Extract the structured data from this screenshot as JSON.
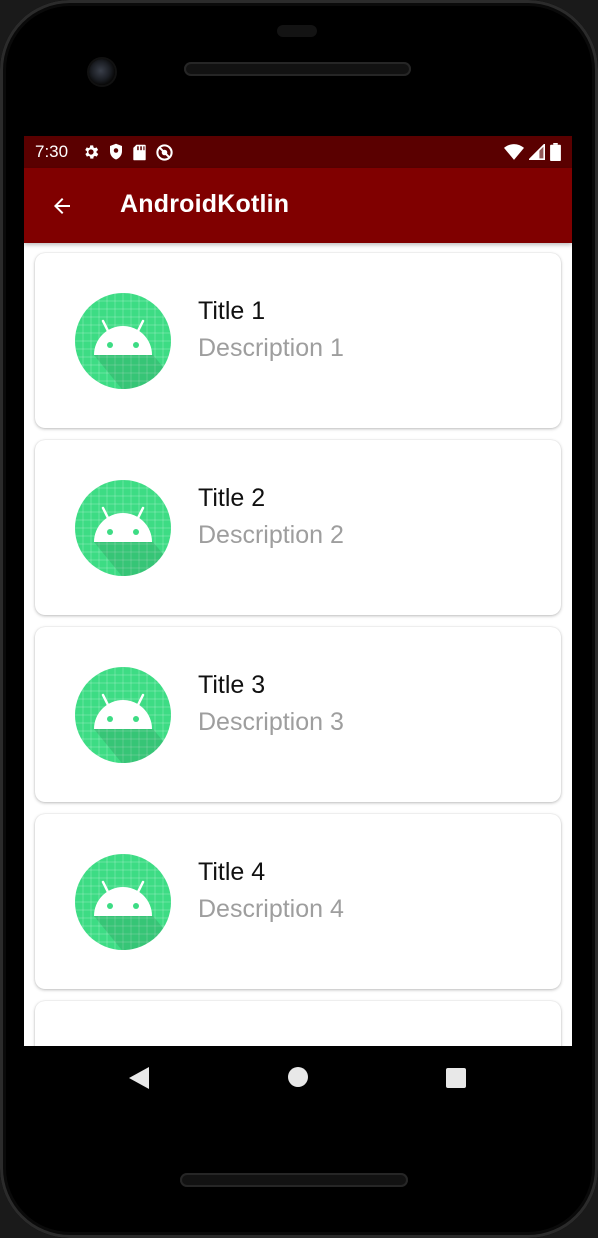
{
  "status_bar": {
    "time": "7:30",
    "left_icons": [
      "settings-icon",
      "shield-icon",
      "sd-card-icon",
      "sync-disabled-icon"
    ],
    "right_icons": [
      "wifi-icon",
      "cell-signal-icon",
      "battery-icon"
    ]
  },
  "app_bar": {
    "title": "AndroidKotlin",
    "back_icon": "arrow-back-icon",
    "color": "#800000",
    "status_color": "#5a0000"
  },
  "items": [
    {
      "title": "Title 1",
      "description": "Description 1",
      "icon": "android-icon"
    },
    {
      "title": "Title 2",
      "description": "Description 2",
      "icon": "android-icon"
    },
    {
      "title": "Title 3",
      "description": "Description 3",
      "icon": "android-icon"
    },
    {
      "title": "Title 4",
      "description": "Description 4",
      "icon": "android-icon"
    }
  ],
  "nav_bar": {
    "buttons": [
      "nav-back-icon",
      "nav-home-icon",
      "nav-recents-icon"
    ]
  },
  "colors": {
    "android_green": "#3ddc84",
    "title_text": "#111111",
    "description_text": "#9e9e9e"
  }
}
